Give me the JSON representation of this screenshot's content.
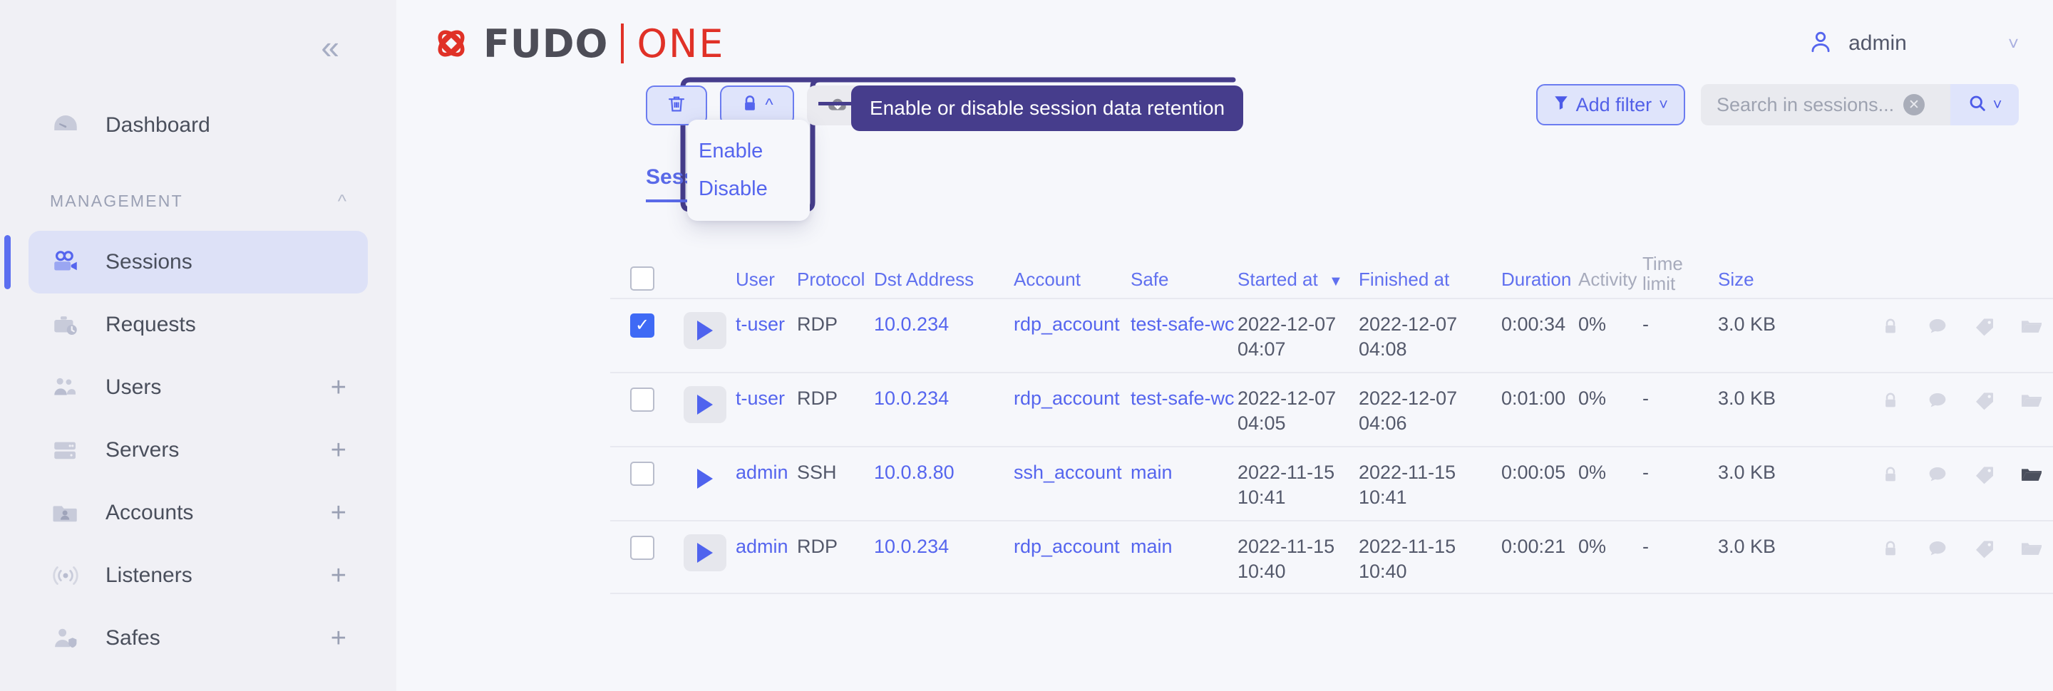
{
  "sidebar": {
    "collapse_icon": "chevron-double-left-icon",
    "dashboard": {
      "label": "Dashboard",
      "icon": "gauge-icon"
    },
    "section": {
      "label": "MANAGEMENT",
      "chevron": "chevron-up-icon"
    },
    "items": [
      {
        "label": "Sessions",
        "icon": "video-camera-icon",
        "active": true,
        "plus": ""
      },
      {
        "label": "Requests",
        "icon": "briefcase-clock-icon",
        "active": false,
        "plus": ""
      },
      {
        "label": "Users",
        "icon": "users-icon",
        "active": false,
        "plus": "+"
      },
      {
        "label": "Servers",
        "icon": "server-icon",
        "active": false,
        "plus": "+"
      },
      {
        "label": "Accounts",
        "icon": "folder-user-icon",
        "active": false,
        "plus": "+"
      },
      {
        "label": "Listeners",
        "icon": "broadcast-icon",
        "active": false,
        "plus": "+"
      },
      {
        "label": "Safes",
        "icon": "user-shield-icon",
        "active": false,
        "plus": "+"
      }
    ]
  },
  "header": {
    "logo_fudo": "FUDO",
    "logo_one": "ONE",
    "logo_mark": "fudo-logo-icon",
    "logo_color_dark": "#4d4d57",
    "logo_color_red": "#e03127",
    "user": "admin",
    "user_icon": "person-icon",
    "user_chevron": "chevron-down-icon"
  },
  "toolbar": {
    "delete_icon": "trash-icon",
    "retention_icon": "lock-icon",
    "retention_chevron": "chevron-up-icon",
    "download_icon": "cloud-download-icon"
  },
  "dropdown": {
    "items": [
      {
        "label": "Enable"
      },
      {
        "label": "Disable"
      }
    ]
  },
  "tooltip": {
    "text": "Enable or disable session data retention",
    "color": "#463d8c"
  },
  "filters": {
    "add_filter_label": "Add filter",
    "filter_icon": "funnel-icon",
    "filter_chevron": "chevron-down-icon",
    "search_value": "",
    "search_placeholder": "Search in sessions...",
    "clear_icon": "clear-x-icon",
    "search_icon": "magnifier-icon",
    "search_chevron": "chevron-down-icon"
  },
  "tabs": [
    {
      "label": "Sessions",
      "active": true
    }
  ],
  "table": {
    "headers": {
      "user": "User",
      "protocol": "Protocol",
      "dst_address": "Dst Address",
      "account": "Account",
      "safe": "Safe",
      "started_at": "Started at",
      "started_sort": "▼",
      "finished_at": "Finished at",
      "duration": "Duration",
      "activity": "Activity",
      "time_limit_l1": "Time",
      "time_limit_l2": "limit",
      "size": "Size"
    },
    "action_icons": [
      "lock-icon",
      "comment-icon",
      "tag-icon",
      "folder-icon",
      "share-icon",
      "archive-icon"
    ],
    "rows": [
      {
        "checked": true,
        "play_bg": true,
        "user": "t-user",
        "protocol": "RDP",
        "dst_address": "10.0.234",
        "account": "rdp_account",
        "safe": "test-safe-wc",
        "started_at": "2022-12-07 04:07",
        "finished_at": "2022-12-07 04:08",
        "duration": "0:00:34",
        "activity": "0%",
        "time_limit": "-",
        "size": "3.0 KB",
        "folder_active": false,
        "share_active": true
      },
      {
        "checked": false,
        "play_bg": true,
        "user": "t-user",
        "protocol": "RDP",
        "dst_address": "10.0.234",
        "account": "rdp_account",
        "safe": "test-safe-wc",
        "started_at": "2022-12-07 04:05",
        "finished_at": "2022-12-07 04:06",
        "duration": "0:01:00",
        "activity": "0%",
        "time_limit": "-",
        "size": "3.0 KB",
        "folder_active": false,
        "share_active": true
      },
      {
        "checked": false,
        "play_bg": false,
        "user": "admin",
        "protocol": "SSH",
        "dst_address": "10.0.8.80",
        "account": "ssh_account",
        "safe": "main",
        "started_at": "2022-11-15 10:41",
        "finished_at": "2022-11-15 10:41",
        "duration": "0:00:05",
        "activity": "0%",
        "time_limit": "-",
        "size": "3.0 KB",
        "folder_active": true,
        "share_active": true
      },
      {
        "checked": false,
        "play_bg": true,
        "user": "admin",
        "protocol": "RDP",
        "dst_address": "10.0.234",
        "account": "rdp_account",
        "safe": "main",
        "started_at": "2022-11-15 10:40",
        "finished_at": "2022-11-15 10:40",
        "duration": "0:00:21",
        "activity": "0%",
        "time_limit": "-",
        "size": "3.0 KB",
        "folder_active": false,
        "share_active": true
      }
    ]
  }
}
